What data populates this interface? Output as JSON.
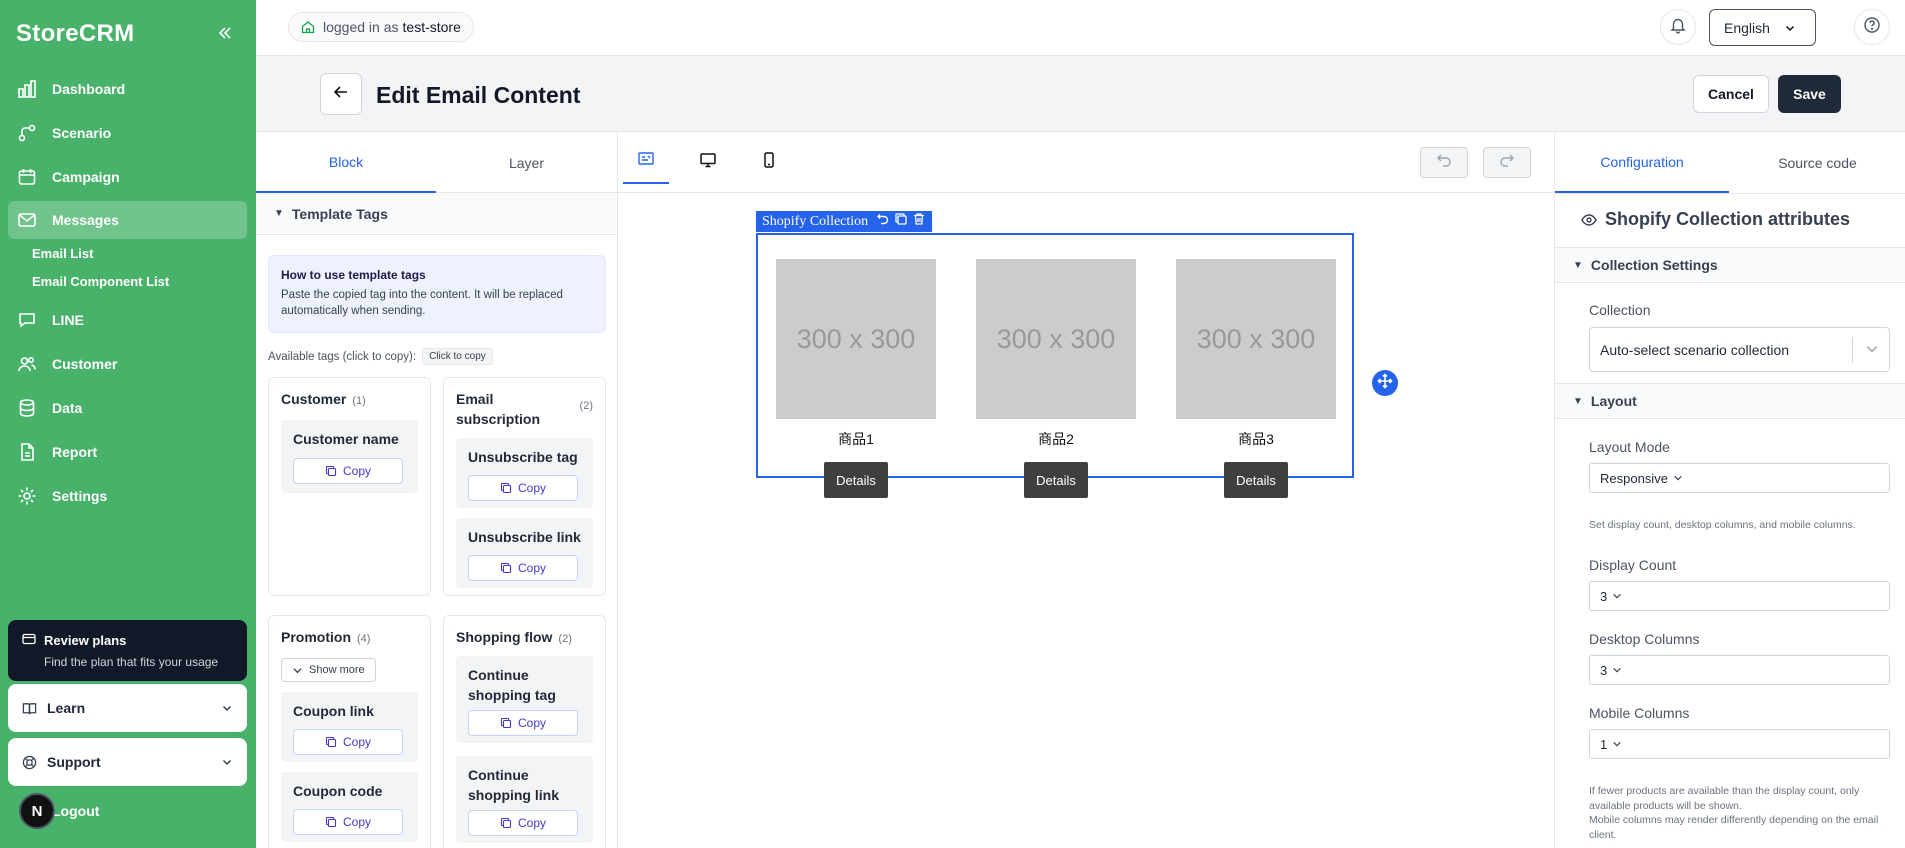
{
  "sidebar": {
    "brand": "StoreCRM",
    "items": [
      {
        "label": "Dashboard"
      },
      {
        "label": "Scenario"
      },
      {
        "label": "Campaign"
      },
      {
        "label": "Messages"
      },
      {
        "label": "LINE"
      },
      {
        "label": "Customer"
      },
      {
        "label": "Data"
      },
      {
        "label": "Report"
      },
      {
        "label": "Settings"
      }
    ],
    "sub_items": [
      {
        "label": "Email List"
      },
      {
        "label": "Email Component List"
      }
    ],
    "review": {
      "title": "Review plans",
      "subtitle": "Find the plan that fits your usage"
    },
    "learn_label": "Learn",
    "support_label": "Support",
    "logout_label": "Logout",
    "avatar_letter": "N",
    "accent": "#48b26b"
  },
  "topbar": {
    "login_prefix": "logged in as",
    "store_name": "test-store",
    "language": "English"
  },
  "header": {
    "title": "Edit Email Content",
    "cancel_label": "Cancel",
    "save_label": "Save"
  },
  "left_panel": {
    "tabs": [
      {
        "label": "Block"
      },
      {
        "label": "Layer"
      }
    ],
    "section_title": "Template Tags",
    "info_title": "How to use template tags",
    "info_text": "Paste the copied tag into the content. It will be replaced automatically when sending.",
    "available_label": "Available tags (click to copy):",
    "click_chip": "Click to copy",
    "copy_label": "Copy",
    "show_more_label": "Show more",
    "groups": [
      {
        "title": "Customer",
        "count": "(1)",
        "tags": [
          "Customer name"
        ]
      },
      {
        "title": "Email subscription",
        "count": "(2)",
        "tags": [
          "Unsubscribe tag",
          "Unsubscribe link"
        ]
      },
      {
        "title": "Promotion",
        "count": "(4)",
        "tags": [
          "Coupon link",
          "Coupon code"
        ]
      },
      {
        "title": "Shopping flow",
        "count": "(2)",
        "tags": [
          "Continue shopping tag",
          "Continue shopping link"
        ]
      }
    ]
  },
  "canvas": {
    "block_label": "Shopify Collection",
    "products": [
      {
        "placeholder": "300 x 300",
        "name": "商品1",
        "button": "Details"
      },
      {
        "placeholder": "300 x 300",
        "name": "商品2",
        "button": "Details"
      },
      {
        "placeholder": "300 x 300",
        "name": "商品3",
        "button": "Details"
      }
    ],
    "accent": "#2563eb"
  },
  "right_panel": {
    "tabs": [
      {
        "label": "Configuration"
      },
      {
        "label": "Source code"
      }
    ],
    "title": "Shopify Collection attributes",
    "collection_section": "Collection Settings",
    "collection_label": "Collection",
    "collection_value": "Auto-select scenario collection",
    "layout_section": "Layout",
    "layout_mode_label": "Layout Mode",
    "layout_mode_value": "Responsive",
    "layout_hint": "Set display count, desktop columns, and mobile columns.",
    "display_count_label": "Display Count",
    "display_count_value": "3",
    "desktop_columns_label": "Desktop Columns",
    "desktop_columns_value": "3",
    "mobile_columns_label": "Mobile Columns",
    "mobile_columns_value": "1",
    "footer_hint_1": "If fewer products are available than the display count, only available products will be shown.",
    "footer_hint_2": "Mobile columns may render differently depending on the email client."
  }
}
